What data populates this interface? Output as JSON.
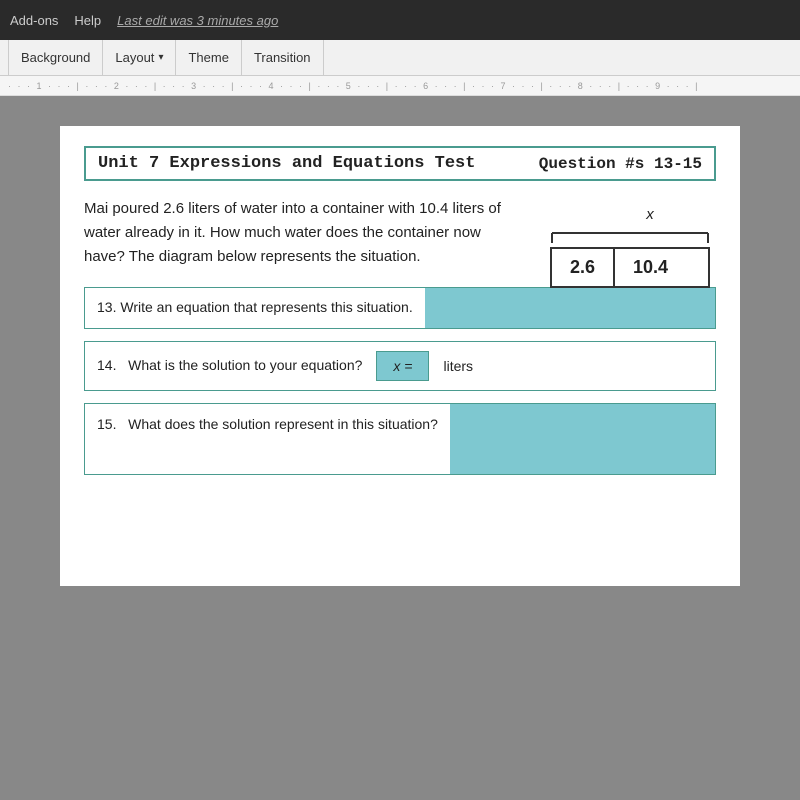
{
  "topbar": {
    "addons_label": "Add-ons",
    "help_label": "Help",
    "last_edit_label": "Last edit was 3 minutes ago"
  },
  "toolbar": {
    "background_label": "Background",
    "layout_label": "Layout",
    "layout_arrow": "▾",
    "theme_label": "Theme",
    "transition_label": "Transition"
  },
  "ruler": {
    "marks": "· · · 1 · · · | · · · 2 · · · | · · · 3 · · · | · · · 4 · · · | · · · 5 · · · | · · · 6 · · · | · · · 7 · · · | · · · 8 · · · | · · · 9 · · · |"
  },
  "slide": {
    "title": "Unit 7 Expressions and Equations Test",
    "question_label": "Question #s 13-15",
    "problem_text": "Mai poured 2.6 liters of water into a container with 10.4 liters of water already in it. How much water does the container now have? The diagram below represents the situation.",
    "diagram": {
      "x_label": "x",
      "cell1": "2.6",
      "cell2": "10.4"
    },
    "q13": {
      "number": "13.",
      "text": "Write an equation that represents this situation."
    },
    "q14": {
      "number": "14.",
      "text": "What is the solution to your equation?",
      "x_equals": "x =",
      "liters": "liters"
    },
    "q15": {
      "number": "15.",
      "text": "What does the solution represent in this situation?"
    }
  }
}
